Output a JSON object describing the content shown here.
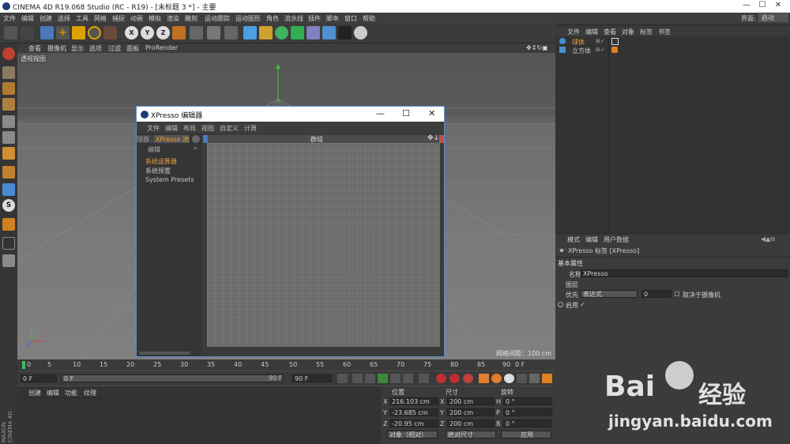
{
  "window": {
    "title": "CINEMA 4D R19.068 Studio (RC - R19) - [未标题 3 *] - 主要"
  },
  "menubar": [
    "文件",
    "编辑",
    "创建",
    "选择",
    "工具",
    "网格",
    "捕捉",
    "动画",
    "模拟",
    "渲染",
    "雕刻",
    "运动跟踪",
    "运动图形",
    "角色",
    "流水线",
    "插件",
    "脚本",
    "窗口",
    "帮助"
  ],
  "interface": {
    "label": "界面:",
    "value": "启动"
  },
  "viewport": {
    "menu": [
      "查看",
      "摄像机",
      "显示",
      "选项",
      "过滤",
      "面板",
      "ProRender"
    ],
    "label": "透视视图",
    "grid": "网格间距：100 cm"
  },
  "xpresso": {
    "title": "XPresso 编辑器",
    "menu": [
      "文件",
      "编辑",
      "布局",
      "视图",
      "自定义",
      "计算"
    ],
    "tab_left": "理器",
    "tab_active": "XPresso 池",
    "edit_label": "编辑",
    "tree": [
      "系统运算器",
      "系统预置",
      "System Presets"
    ],
    "group_label": "群组"
  },
  "objects": {
    "menu": [
      "文件",
      "编辑",
      "查看",
      "对象",
      "标签",
      "书签"
    ],
    "items": [
      "球体",
      "立方体"
    ]
  },
  "attributes": {
    "menu": [
      "模式",
      "编辑",
      "用户数据"
    ],
    "tag_title": "XPresso 标签 [XPresso]",
    "section": "基本属性",
    "name_label": "名称",
    "name_value": "XPresso",
    "layer_label": "图层",
    "priority_label": "优先",
    "priority_value": "表达式",
    "priority_num": "0",
    "camera_label": "取决于摄像机",
    "enable_label": "启用",
    "enable_check": "✓"
  },
  "timeline": {
    "ticks": [
      "0",
      "5",
      "10",
      "15",
      "20",
      "25",
      "30",
      "35",
      "40",
      "45",
      "50",
      "55",
      "60",
      "65",
      "70",
      "75",
      "80",
      "85",
      "90"
    ],
    "frame_end": "0 F"
  },
  "transport": {
    "start": "0 F",
    "field": "0 F",
    "end_a": "90 F",
    "end_b": "90 F"
  },
  "material": {
    "menu": [
      "创建",
      "编辑",
      "功能",
      "纹理"
    ]
  },
  "coords": {
    "headers": [
      "位置",
      "尺寸",
      "旋转"
    ],
    "rows": [
      {
        "a": "X",
        "pos": "216.103 cm",
        "b": "X",
        "size": "200 cm",
        "c": "H",
        "rot": "0 °"
      },
      {
        "a": "Y",
        "pos": "-23.685 cm",
        "b": "Y",
        "size": "200 cm",
        "c": "P",
        "rot": "0 °"
      },
      {
        "a": "Z",
        "pos": "-20.95 cm",
        "b": "Z",
        "size": "200 cm",
        "c": "B",
        "rot": "0 °"
      }
    ],
    "mode": "对象（相对）",
    "size_mode": "绝对尺寸",
    "apply": "应用"
  },
  "brand": {
    "maxon": "MAXON",
    "c4d": "CINEMA 4D"
  },
  "watermark": {
    "logo": "Bai",
    "logo2": "经验",
    "url": "jingyan.baidu.com"
  }
}
